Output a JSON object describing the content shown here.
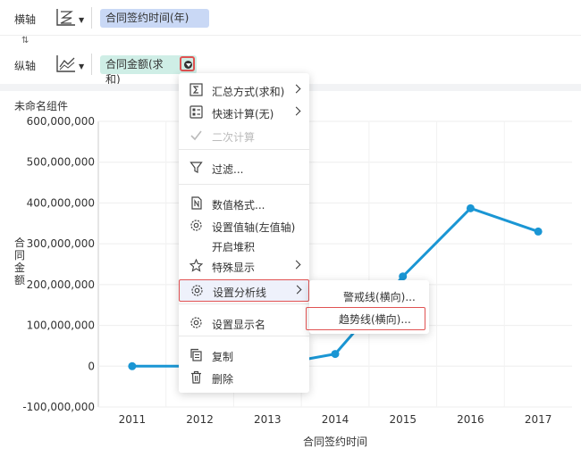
{
  "axes": {
    "x": {
      "label": "横轴",
      "field": "合同签约时间(年)"
    },
    "y": {
      "label": "纵轴",
      "field": "合同金额(求和)"
    }
  },
  "swap_glyph": "⇅",
  "component_title": "未命名组件",
  "icons": {
    "x_axis": "bar-chart-type-icon",
    "y_axis": "line-chart-type-icon",
    "dropdown": "caret-down-icon"
  },
  "colors": {
    "series": "#1a96d4",
    "x_pill": "#c9d8f5",
    "y_pill": "#cfeee6",
    "highlight_border": "#e05252"
  },
  "menu": {
    "items": [
      {
        "label": "汇总方式(求和)",
        "icon": "sigma-icon",
        "submenu": true
      },
      {
        "label": "快速计算(无)",
        "icon": "quick-calc-icon",
        "submenu": true
      },
      {
        "label": "二次计算",
        "icon": "check-icon",
        "disabled": true
      },
      {
        "label": "过滤...",
        "icon": "filter-icon"
      },
      {
        "label": "数值格式...",
        "icon": "number-format-icon"
      },
      {
        "label": "设置值轴(左值轴)",
        "icon": "gear-icon"
      },
      {
        "label": "开启堆积",
        "icon": ""
      },
      {
        "label": "特殊显示",
        "icon": "star-icon",
        "submenu": true
      },
      {
        "label": "设置分析线",
        "icon": "gear-icon",
        "submenu": true,
        "highlighted": true
      },
      {
        "label": "设置显示名",
        "icon": "gear-icon"
      },
      {
        "label": "复制",
        "icon": "copy-icon"
      },
      {
        "label": "删除",
        "icon": "trash-icon"
      }
    ],
    "submenu": [
      {
        "label": "警戒线(横向)..."
      },
      {
        "label": "趋势线(横向)...",
        "highlighted": true
      }
    ]
  },
  "chart_data": {
    "type": "line",
    "xlabel": "合同签约时间",
    "ylabel": "合同金额",
    "categories": [
      "2011",
      "2012",
      "2013",
      "2014",
      "2015",
      "2016",
      "2017"
    ],
    "series": [
      {
        "values": [
          0,
          0,
          0,
          30000000,
          220000000,
          387000000,
          330000000
        ]
      }
    ],
    "ylim": [
      -100000000,
      600000000
    ],
    "y_ticks": [
      -100000000,
      0,
      100000000,
      200000000,
      300000000,
      400000000,
      500000000,
      600000000
    ],
    "y_tick_labels": [
      "-100,000,000",
      "0",
      "100,000,000",
      "200,000,000",
      "300,000,000",
      "400,000,000",
      "500,000,000",
      "600,000,000"
    ],
    "grid": true
  }
}
